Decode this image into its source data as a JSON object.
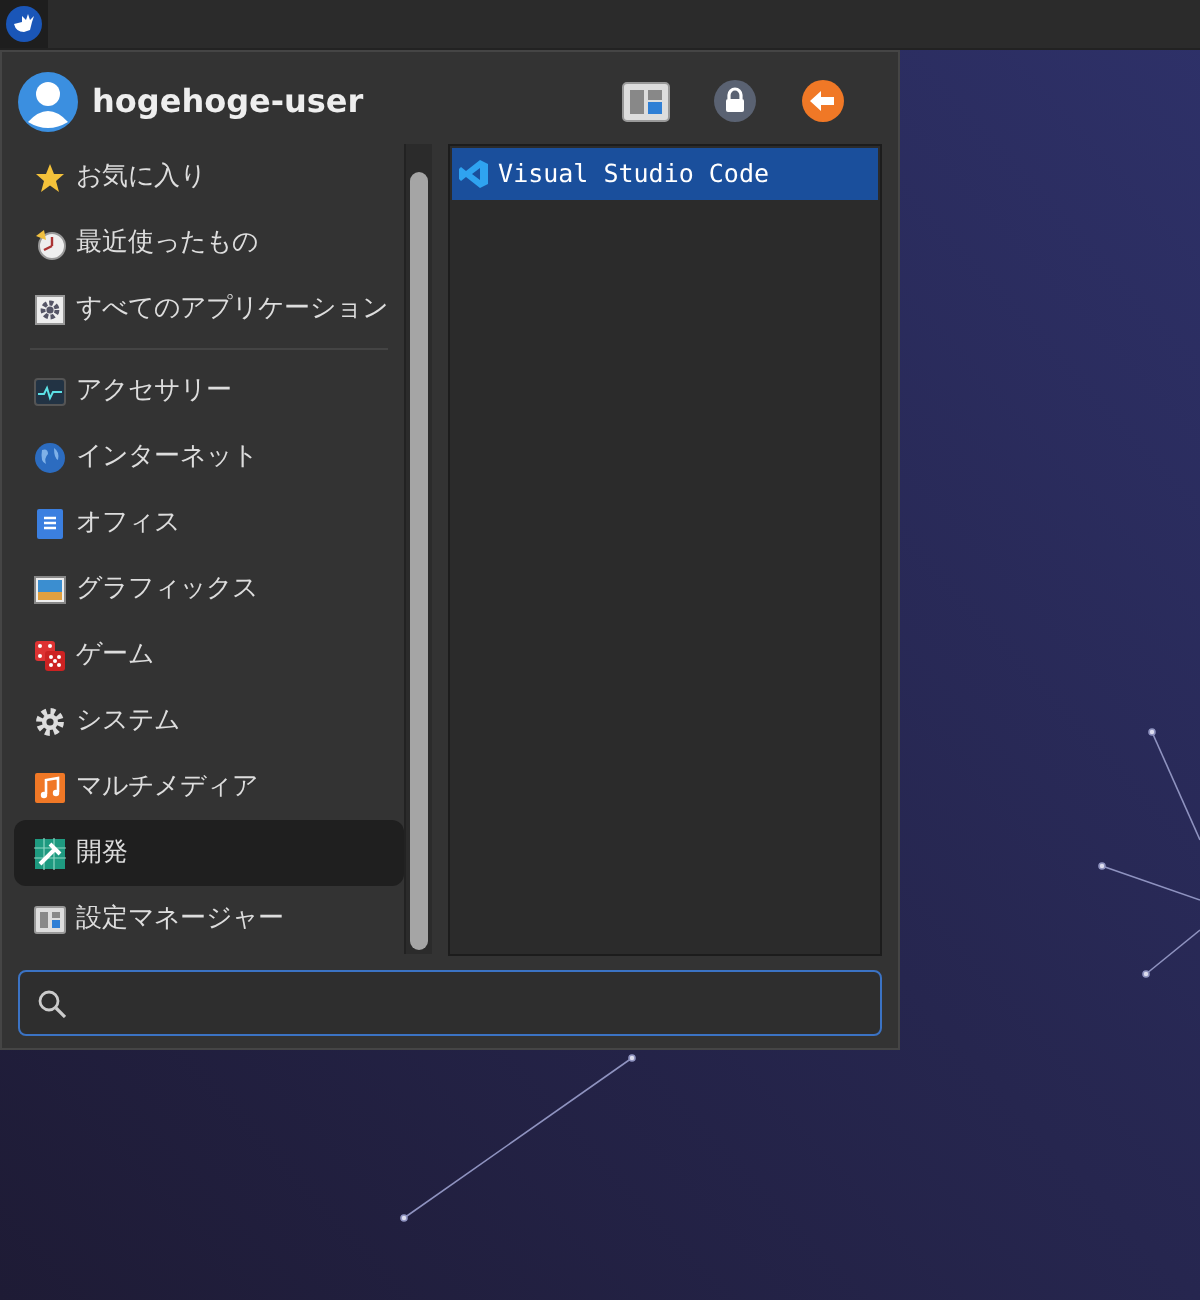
{
  "panel": {
    "launcher_button": {
      "selected": true
    }
  },
  "menu": {
    "user": "hogehoge-user",
    "places": [
      {
        "label": "お気に入り",
        "selected": false
      },
      {
        "label": "最近使ったもの",
        "selected": false
      },
      {
        "label": "すべてのアプリケーション",
        "selected": false
      }
    ],
    "categories": [
      {
        "label": "アクセサリー",
        "selected": false
      },
      {
        "label": "インターネット",
        "selected": false
      },
      {
        "label": "オフィス",
        "selected": false
      },
      {
        "label": "グラフィックス",
        "selected": false
      },
      {
        "label": "ゲーム",
        "selected": false
      },
      {
        "label": "システム",
        "selected": false
      },
      {
        "label": "マルチメディア",
        "selected": false
      },
      {
        "label": "開発",
        "selected": true
      },
      {
        "label": "設定マネージャー",
        "selected": false
      }
    ],
    "applications": [
      {
        "label": "Visual Studio Code",
        "selected": true
      }
    ]
  }
}
